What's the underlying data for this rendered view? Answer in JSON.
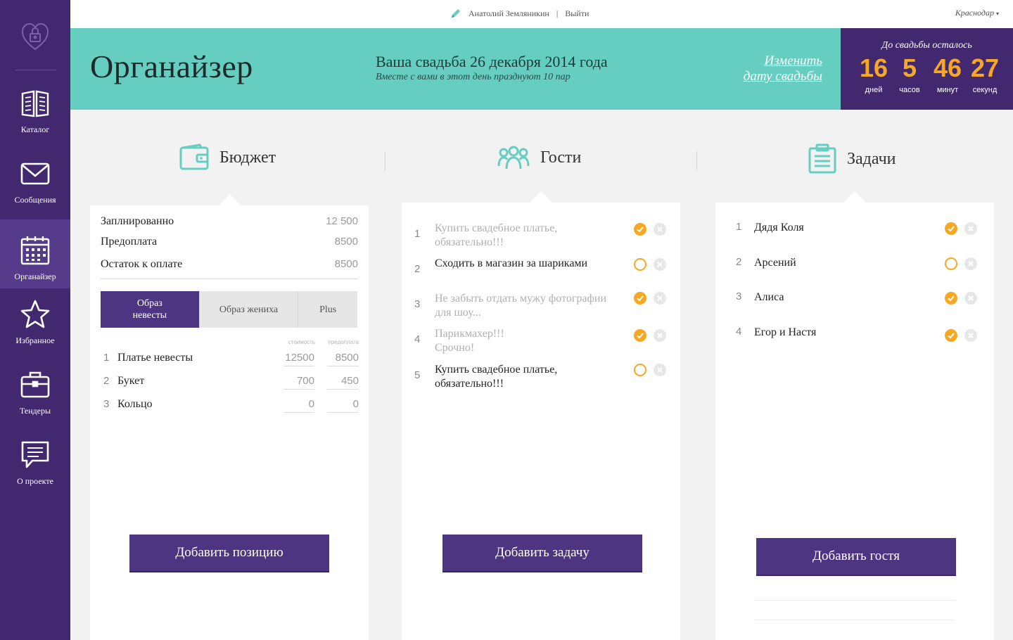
{
  "sidebar": {
    "logo_icon": "heart-lock-icon",
    "items": [
      {
        "label": "Каталог",
        "icon": "book-icon"
      },
      {
        "label": "Сообщения",
        "icon": "envelope-icon"
      },
      {
        "label": "Органайзер",
        "icon": "calendar-icon",
        "active": true
      },
      {
        "label": "Избранное",
        "icon": "star-icon"
      },
      {
        "label": "Тендеры",
        "icon": "briefcase-icon"
      },
      {
        "label": "О проекте",
        "icon": "speech-bubble-icon"
      }
    ]
  },
  "topbar": {
    "user_name": "Анатолий Земляникин",
    "separator": "|",
    "logout": "Выйти",
    "city": "Краснодар",
    "city_caret": "▾"
  },
  "header": {
    "title": "Органайзер",
    "wedding_date": "Ваша свадьба 26 декабря 2014 года",
    "wedding_sub": "Вместе с вами в этот день празднуют 10 пар",
    "change_line1": "Изменить",
    "change_line2": "дату свадьбы"
  },
  "countdown": {
    "title": "До свадьбы осталось",
    "days": "16",
    "days_label": "дней",
    "hours": "5",
    "hours_label": "часов",
    "minutes": "46",
    "minutes_label": "минут",
    "seconds": "27",
    "seconds_label": "секунд"
  },
  "sections": {
    "budget": "Бюджет",
    "guests": "Гости",
    "tasks": "Задачи"
  },
  "budget": {
    "planned_label": "Заплнированно",
    "planned_value": "12 500",
    "prepaid_label": "Предоплата",
    "prepaid_value": "8500",
    "remaining_label": "Остаток к оплате",
    "remaining_value": "8500",
    "tabs": [
      "Образ невесты",
      "Образ жениха",
      "Plus"
    ],
    "col_cost": "стоимость",
    "col_prepay": "предоплата",
    "items": [
      {
        "num": "1",
        "name": "Платье невесты",
        "cost": "12500",
        "prepay": "8500"
      },
      {
        "num": "2",
        "name": "Букет",
        "cost": "700",
        "prepay": "450"
      },
      {
        "num": "3",
        "name": "Кольцо",
        "cost": "0",
        "prepay": "0"
      }
    ],
    "add_button": "Добавить позицию"
  },
  "tasks_list": {
    "items": [
      {
        "num": "1",
        "text": "Купить свадебное платье, обязательно!!!",
        "done": true
      },
      {
        "num": "2",
        "text": "Сходить в магазин за шариками",
        "done": false
      },
      {
        "num": "3",
        "text": "Не забыть отдать мужу фотографии для шоу...",
        "done": true
      },
      {
        "num": "4",
        "text": "Парикмахер!!! Срочно!",
        "done": true
      },
      {
        "num": "5",
        "text": "Купить свадебное платье, обязательно!!!",
        "done": false
      }
    ],
    "add_button": "Добавить задачу"
  },
  "guests_list": {
    "items": [
      {
        "num": "1",
        "name": "Дядя Коля",
        "done": true
      },
      {
        "num": "2",
        "name": "Арсений",
        "done": false
      },
      {
        "num": "3",
        "name": "Алиса",
        "done": true
      },
      {
        "num": "4",
        "name": "Егор и Настя",
        "done": true
      }
    ],
    "add_button": "Добавить гостя"
  },
  "colors": {
    "sidebar": "#42296f",
    "header": "#66cdc1",
    "accent": "#f7a823",
    "button": "#4e3581"
  }
}
